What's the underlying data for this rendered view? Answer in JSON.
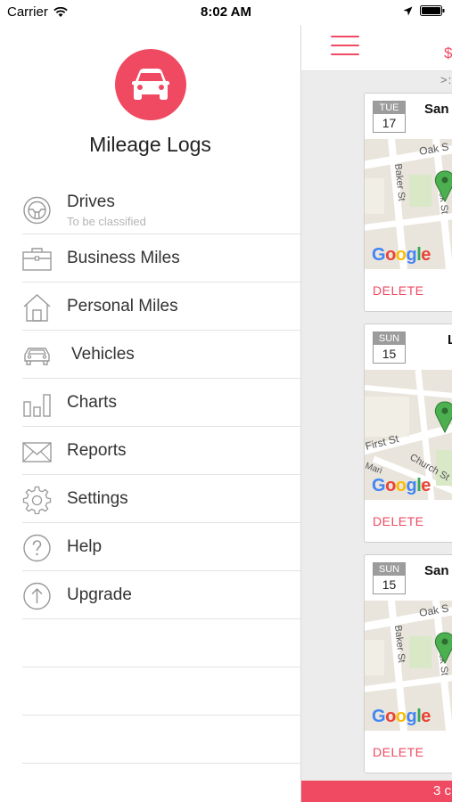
{
  "status_bar": {
    "carrier": "Carrier",
    "time": "8:02 AM"
  },
  "drawer": {
    "app_title": "Mileage Logs",
    "brand_color": "#ef4a62",
    "menu": [
      {
        "label": "Drives",
        "sub": "To be classified",
        "icon": "steering-wheel-icon"
      },
      {
        "label": "Business Miles",
        "icon": "briefcase-icon"
      },
      {
        "label": "Personal Miles",
        "icon": "house-icon"
      },
      {
        "label": "Vehicles",
        "icon": "car-icon"
      },
      {
        "label": "Charts",
        "icon": "bar-chart-icon"
      },
      {
        "label": "Reports",
        "icon": "envelope-icon"
      },
      {
        "label": "Settings",
        "icon": "gear-icon"
      },
      {
        "label": "Help",
        "icon": "question-icon"
      },
      {
        "label": "Upgrade",
        "icon": "upgrade-arrow-icon"
      }
    ]
  },
  "content": {
    "header_amount": "$",
    "subheader": ">:",
    "cards": [
      {
        "dow": "TUE",
        "day": "17",
        "title": "San",
        "streets": [
          "Oak S",
          "Baker St",
          "ck St"
        ],
        "google": "Google",
        "delete": "DELETE"
      },
      {
        "dow": "SUN",
        "day": "15",
        "title": "L",
        "streets": [
          "First St",
          "Church St",
          "Mari"
        ],
        "google": "Google",
        "delete": "DELETE"
      },
      {
        "dow": "SUN",
        "day": "15",
        "title": "San",
        "streets": [
          "Oak S",
          "Baker St",
          "ck St"
        ],
        "google": "Google",
        "delete": "DELETE"
      }
    ],
    "bottom_text": "3 c"
  }
}
